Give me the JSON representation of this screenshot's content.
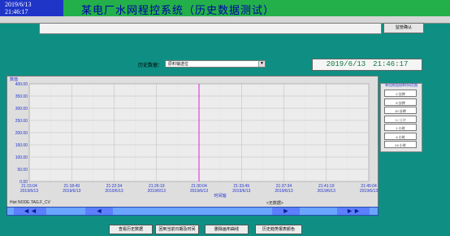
{
  "header": {
    "clock_date": "2019/6/13",
    "clock_time": "21:46:17",
    "title": "某电厂水网程控系统（历史数据测试）",
    "confirm_label": "监管确认"
  },
  "selector": {
    "label": "历史数据：",
    "value": "原料输送位"
  },
  "datetime_display": "2019/6/13　21:46:17",
  "chart_data": {
    "type": "line",
    "title": "",
    "ylabel": "数值",
    "xlabel": "时间轴",
    "ylim": [
      0,
      400
    ],
    "yticks": [
      "400.00",
      "350.00",
      "300.00",
      "250.00",
      "200.00",
      "150.00",
      "100.00",
      "50.00",
      "0.00"
    ],
    "xticks": [
      {
        "time": "21:15:04",
        "date": "2019/6/13"
      },
      {
        "time": "21:18:49",
        "date": "2019/6/13"
      },
      {
        "time": "21:22:34",
        "date": "2019/6/13"
      },
      {
        "time": "21:26:19",
        "date": "2019/6/13"
      },
      {
        "time": "21:30:04",
        "date": "2019/6/13"
      },
      {
        "time": "21:33:49",
        "date": "2019/6/13"
      },
      {
        "time": "21:37:34",
        "date": "2019/6/13"
      },
      {
        "time": "21:41:19",
        "date": "2019/6/13"
      },
      {
        "time": "21:45:04",
        "date": "2019/6/13"
      }
    ],
    "cursor_time": "21:30:04",
    "grid": true,
    "series": [],
    "colors": {
      "cursor": "#e020e0",
      "grid": "#bcbcbc",
      "plot_bg": "#ececec",
      "labels": "#2233cc"
    }
  },
  "tag_label": "Hist NODE.TAG.F_CV",
  "detail_link": "<无数据>",
  "nav": {
    "fast_back": "◄◄",
    "back": "◄",
    "forward": "►",
    "fast_forward": "►►"
  },
  "period_panel": {
    "caption": "单击按钮选择时间范围",
    "options": [
      "2 分钟",
      "5 分钟",
      "10 分钟",
      "30 分钟",
      "1 小时",
      "4 小时",
      "24 小时"
    ],
    "muted_index": 3
  },
  "bottom_buttons": [
    "查看历史数据",
    "回到当前日期及时间",
    "删除画布曲线",
    "历史趋势报表颜色"
  ],
  "colors": {
    "background": "#0f8f83",
    "title_bar": "#23b04a",
    "clock_bg": "#1f35c8",
    "nav_bar": "#6aa6ff"
  }
}
